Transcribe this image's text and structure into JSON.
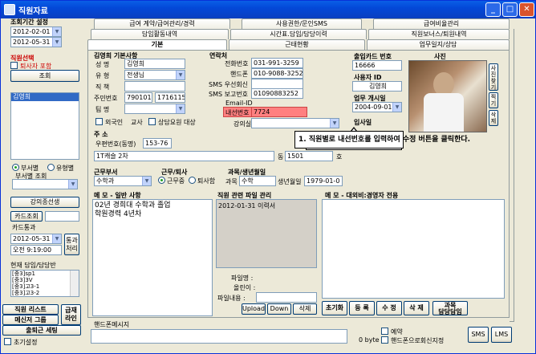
{
  "window": {
    "title": "직원자료"
  },
  "left": {
    "period_label": "조회기간 설정",
    "date_from": "2012-02-01",
    "date_to": "2012-05-31",
    "emp_select_label": "직원선택",
    "include_retired": "퇴사자 포함",
    "search_button": "조회",
    "employee_list": [
      "김영희"
    ],
    "radio_by_dept": "부서별",
    "radio_by_type": "유형별",
    "dept_search_label": "부서별 조회",
    "lecture_button": "강의종선생",
    "card_search_button": "카드조회",
    "card_pass_label": "카드통과",
    "card_date": "2012-05-31",
    "card_time": "오전  9:19:00",
    "pass_button": "통과\n처리",
    "current_class_label": "현재 담임/담당반",
    "class_list": [
      "[중3]sp1",
      "[중3]3V",
      "[중3]고3-1",
      "[중3]고3-2"
    ],
    "emp_list_button": "직원 리스트",
    "messenger_button": "메신저 그룹",
    "pay_button": "급재\n라인",
    "attendance_button": "출퇴근 세팅",
    "init_label": "초기설정"
  },
  "tabs": {
    "row1": [
      "급여 계약/급여관리/경력",
      "사용권한/문인SMS",
      "급여비율관리"
    ],
    "row2": [
      "담임활동내역",
      "시간표.담임/담당이력",
      "직원보너스/퇴원내역"
    ],
    "row3": [
      "기본",
      "근태현황",
      "업무일지/상담"
    ]
  },
  "basic": {
    "section": "김영희 기본사항",
    "name_label": "성    명",
    "name": "김영희",
    "type_label": "유    형",
    "type": "전생님",
    "position_label": "직    책",
    "position": "",
    "rrn_label": "주민번호",
    "rrn1": "790101",
    "rrn2": "1716115",
    "team_label": "팀    명",
    "team": "",
    "foreign_label": "외국인",
    "teacher_label": "교사",
    "consult_label": "상담요원 대상"
  },
  "contact": {
    "section": "연락처",
    "phone_label": "전화번호",
    "phone": "031-991-3259",
    "mobile_label": "핸드폰",
    "mobile": "010-9088-3252",
    "sms_recv_label": "SMS 우선회신",
    "sms_recv": "",
    "sms_send_label": "SMS 보고번호",
    "sms_send": "01090883252",
    "email_label": "Email-ID",
    "email": "",
    "ext_label": "내선번호",
    "ext": "7724",
    "gang_label": "강의실",
    "gang": ""
  },
  "address": {
    "section": "주    소",
    "zip_label": "우편번호(동명)",
    "zip": "153-76",
    "addr": "1T캐슬 2차",
    "dong_label": "동",
    "dong": "1501",
    "ho_label": "호"
  },
  "access": {
    "card_label": "출입카드 번호",
    "card": "16666",
    "user_label": "사용자 ID",
    "user": "김영희",
    "start_label": "업무 개시일",
    "start": "2004-09-01",
    "join_label": "입사일"
  },
  "photo": {
    "label": "사진",
    "side_buttons": [
      "사",
      "진",
      "찾",
      "기",
      "찍",
      "기",
      "삭",
      "제",
      "확",
      "대"
    ]
  },
  "dept": {
    "label": "근무부서",
    "value": "수학과"
  },
  "status": {
    "label": "근무/퇴사",
    "working": "근무중",
    "retired": "퇴사함"
  },
  "subject": {
    "label": "과목/생년월일",
    "subject_label": "과목",
    "subject": "수학",
    "birth_label": "생년월일",
    "birth": "1979-01-0"
  },
  "memo1": {
    "label": "메    모 - 일반 사항",
    "text": "02년 경희대 수학과 졸업\n학원경력 4년차"
  },
  "files": {
    "label": "직원 관련 파일 관리",
    "items": [
      "2012-01-31 이력서"
    ],
    "file_name_label": "파일명 :",
    "owner_label": "올린이 :",
    "content_label": "파일내용 :",
    "upload": "Upload",
    "download": "Down",
    "delete": "삭제"
  },
  "memo2": {
    "label": "메    모 - 대외비:경영자 전용"
  },
  "bottom_buttons": {
    "reset": "초기화",
    "register": "등   록",
    "modify": "수   정",
    "delete": "삭   제",
    "subject_class": "과목\n담당담임"
  },
  "sms": {
    "label": "핸드폰메시지",
    "bytes": "0 byte",
    "reserve": "예약",
    "send_to_mobile": "핸드폰으로회신지정",
    "sms": "SMS",
    "lms": "LMS"
  },
  "tooltip": "1. 직원별로 내선번호를 입력하여 수정 버튼을 클릭한다.",
  "colors": {
    "title_bar": "#0a5fe6",
    "highlight": "#ff8080",
    "close": "#d9542d"
  }
}
